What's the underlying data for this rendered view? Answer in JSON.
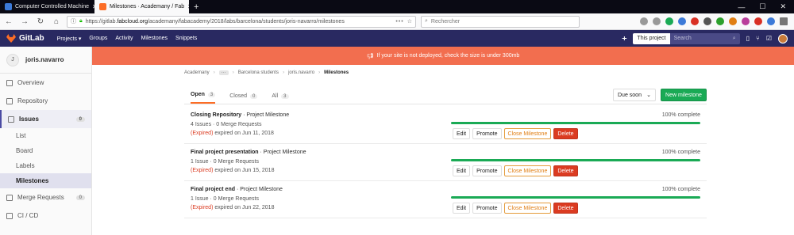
{
  "browser": {
    "tabs": [
      {
        "title": "Computer Controlled Machine",
        "icon_color": "#3c7ad8"
      },
      {
        "title": "Milestones · Academany / Fab",
        "icon_color": "#fc6d26"
      }
    ],
    "url_prefix": "https://gitlab.",
    "url_host": "fabcloud.org",
    "url_path": "/academany/fabacademy/2018/labs/barcelona/students/joris-navarro/milestones",
    "search_placeholder": "Rechercher",
    "new_tab": "+",
    "win_min": "—",
    "win_max": "☐",
    "win_close": "✕",
    "url_dots": "•••"
  },
  "gitlab_nav": {
    "brand": "GitLab",
    "menu": [
      "Projects ▾",
      "Groups",
      "Activity",
      "Milestones",
      "Snippets"
    ],
    "scope_label": "This project",
    "search_placeholder": "Search"
  },
  "sidebar": {
    "avatar_letter": "J",
    "username": "joris.navarro",
    "items": [
      {
        "label": "Overview"
      },
      {
        "label": "Repository"
      },
      {
        "label": "Issues",
        "count": "0"
      },
      {
        "label": "Merge Requests",
        "count": "0"
      },
      {
        "label": "CI / CD"
      }
    ],
    "issues_sub": [
      "List",
      "Board",
      "Labels",
      "Milestones"
    ]
  },
  "banner": {
    "text": "If your site is not deployed, check the size is under 300mb",
    "icon": "megaphone-icon"
  },
  "breadcrumb": [
    "Academany",
    "···",
    "Barcelona students",
    "joris.navarro",
    "Milestones"
  ],
  "filters": {
    "tabs": [
      {
        "label": "Open",
        "count": "3"
      },
      {
        "label": "Closed",
        "count": "0"
      },
      {
        "label": "All",
        "count": "3"
      }
    ],
    "sort_label": "Due soon",
    "new_button": "New milestone"
  },
  "milestones": [
    {
      "title": "Closing Repository",
      "kind": "· Project Milestone",
      "counts": "4 Issues · 0 Merge Requests",
      "expired": "(Expired)",
      "due": "expired on Jun 11, 2018",
      "progress_percent": 100,
      "progress_text": "100% complete"
    },
    {
      "title": "Final project presentation",
      "kind": "· Project Milestone",
      "counts": "1 Issue · 0 Merge Requests",
      "expired": "(Expired)",
      "due": "expired on Jun 15, 2018",
      "progress_percent": 100,
      "progress_text": "100% complete"
    },
    {
      "title": "Final project end",
      "kind": "· Project Milestone",
      "counts": "1 Issue · 0 Merge Requests",
      "expired": "(Expired)",
      "due": "expired on Jun 22, 2018",
      "progress_percent": 100,
      "progress_text": "100% complete"
    }
  ],
  "actions": {
    "edit": "Edit",
    "promote": "Promote",
    "close": "Close Milestone",
    "delete": "Delete"
  },
  "colors": {
    "nav": "#292961",
    "banner": "#f26e4f",
    "success": "#1aaa55",
    "danger": "#db3b21",
    "accent": "#fc6d26"
  }
}
